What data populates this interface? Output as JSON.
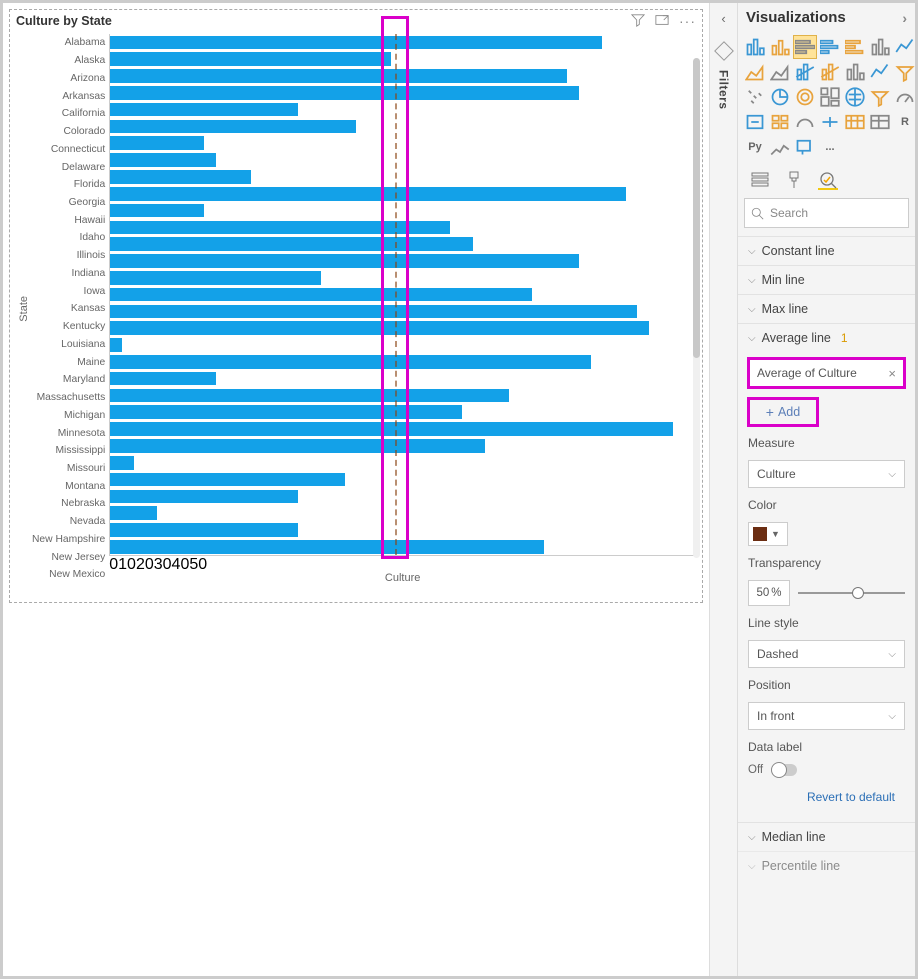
{
  "chart": {
    "title": "Culture by State",
    "xlabel": "Culture",
    "ylabel": "State",
    "xmax": 50,
    "xticks": [
      0,
      10,
      20,
      30,
      40,
      50
    ],
    "avg_line_x": 24.3
  },
  "chart_data": {
    "type": "bar",
    "orientation": "horizontal",
    "title": "Culture by State",
    "xlabel": "Culture",
    "ylabel": "State",
    "xlim": [
      0,
      50
    ],
    "categories": [
      "Alabama",
      "Alaska",
      "Arizona",
      "Arkansas",
      "California",
      "Colorado",
      "Connecticut",
      "Delaware",
      "Florida",
      "Georgia",
      "Hawaii",
      "Idaho",
      "Illinois",
      "Indiana",
      "Iowa",
      "Kansas",
      "Kentucky",
      "Louisiana",
      "Maine",
      "Maryland",
      "Massachusetts",
      "Michigan",
      "Minnesota",
      "Mississippi",
      "Missouri",
      "Montana",
      "Nebraska",
      "Nevada",
      "New Hampshire",
      "New Jersey",
      "New Mexico"
    ],
    "values": [
      42,
      24,
      39,
      40,
      16,
      21,
      8,
      9,
      12,
      44,
      8,
      29,
      31,
      40,
      18,
      36,
      45,
      46,
      1,
      41,
      9,
      34,
      30,
      48,
      32,
      2,
      20,
      16,
      4,
      16,
      37
    ],
    "reference_lines": [
      {
        "label": "Average of Culture",
        "value": 24.3,
        "style": "dashed",
        "color": "#8B4513"
      }
    ]
  },
  "rail": {
    "filters": "Filters"
  },
  "pane": {
    "title": "Visualizations",
    "search_placeholder": "Search",
    "sections": {
      "constant": "Constant line",
      "min": "Min line",
      "max": "Max line",
      "average": "Average line",
      "average_count": "1",
      "median": "Median line",
      "percentile": "Percentile line"
    },
    "avg_item": "Average of Culture",
    "add_label": "Add",
    "measure_label": "Measure",
    "measure_value": "Culture",
    "color_label": "Color",
    "transparency_label": "Transparency",
    "transparency_value": "50",
    "transparency_unit": "%",
    "linestyle_label": "Line style",
    "linestyle_value": "Dashed",
    "position_label": "Position",
    "position_value": "In front",
    "datalabel_label": "Data label",
    "datalabel_state": "Off",
    "revert": "Revert to default"
  }
}
